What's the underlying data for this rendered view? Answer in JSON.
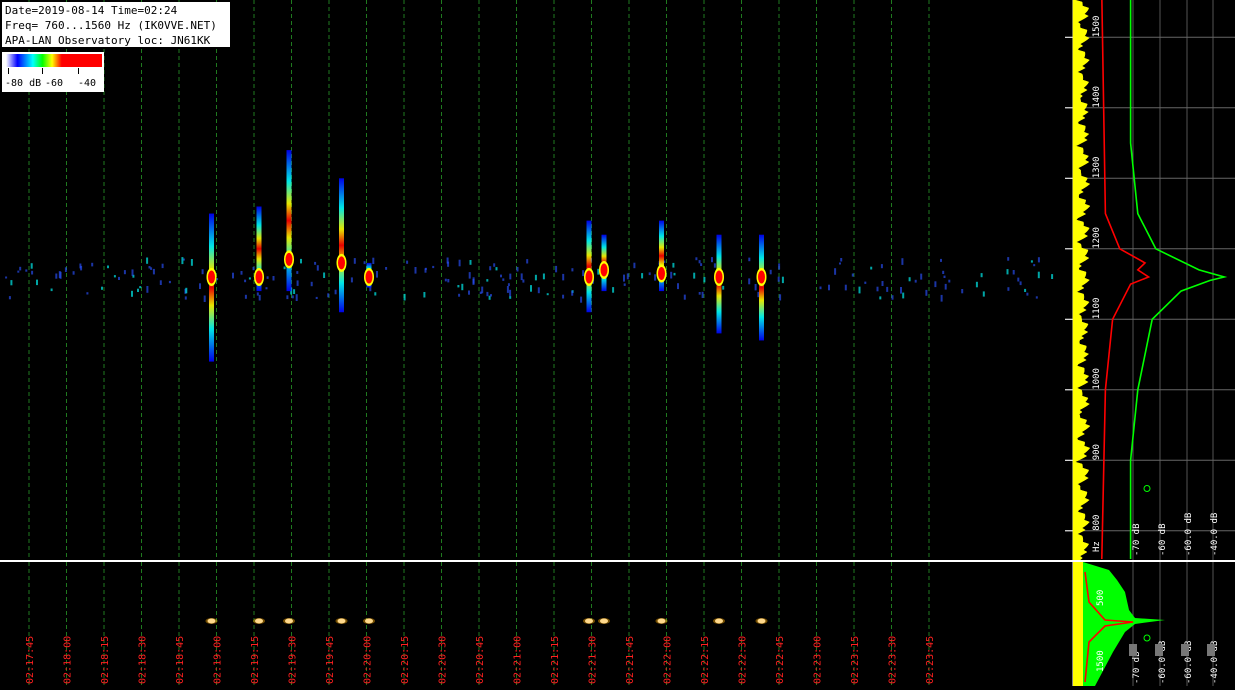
{
  "header": {
    "line1": "Date=2019-08-14 Time=02:24",
    "line2": "Freq= 760...1560 Hz (IK0VVE.NET)",
    "line3": "APA-LAN Observatory loc: JN61KK"
  },
  "scale": {
    "labels": [
      "-80 dB",
      "-60",
      "-40"
    ]
  },
  "colors": {
    "background": "#000000",
    "grid": "#1f7a1f",
    "time_label": "#ff2020",
    "spectrum_peak": "#00ff00",
    "spectrum_avg": "#ff0000",
    "spectrum_inst": "#ffff00"
  },
  "chart_data": [
    {
      "type": "heatmap",
      "title": "Date=2019-08-14 Time=02:24",
      "x_label": "",
      "y_label": "Hz",
      "y_unit": "Hz",
      "yrange": [
        760,
        1560
      ],
      "y_ticks": [
        "800",
        "900",
        "1000",
        "1100",
        "1200",
        "1300",
        "1400",
        "1500"
      ],
      "x_ticks": [
        "02:17:45",
        "02:18:00",
        "02:18:15",
        "02:18:30",
        "02:18:45",
        "02:19:00",
        "02:19:15",
        "02:19:30",
        "02:19:45",
        "02:20:00",
        "02:20:15",
        "02:20:30",
        "02:20:45",
        "02:21:00",
        "02:21:15",
        "02:21:30",
        "02:21:45",
        "02:22:00",
        "02:22:15",
        "02:22:30",
        "02:22:45",
        "02:23:00",
        "02:23:15",
        "02:23:30",
        "02:23:45"
      ],
      "baseline_freq_hz": 1160,
      "events": [
        {
          "time": "02:18:58",
          "freq_hz": 1160,
          "span_hz": [
            1040,
            1250
          ],
          "level_db": -40
        },
        {
          "time": "02:19:17",
          "freq_hz": 1160,
          "span_hz": [
            1140,
            1260
          ],
          "level_db": -45
        },
        {
          "time": "02:19:29",
          "freq_hz": 1185,
          "span_hz": [
            1140,
            1340
          ],
          "level_db": -40
        },
        {
          "time": "02:19:50",
          "freq_hz": 1180,
          "span_hz": [
            1110,
            1300
          ],
          "level_db": -40
        },
        {
          "time": "02:20:01",
          "freq_hz": 1160,
          "span_hz": [
            1145,
            1180
          ],
          "level_db": -45
        },
        {
          "time": "02:21:29",
          "freq_hz": 1160,
          "span_hz": [
            1110,
            1240
          ],
          "level_db": -42
        },
        {
          "time": "02:21:35",
          "freq_hz": 1170,
          "span_hz": [
            1140,
            1220
          ],
          "level_db": -40
        },
        {
          "time": "02:21:58",
          "freq_hz": 1165,
          "span_hz": [
            1140,
            1240
          ],
          "level_db": -40
        },
        {
          "time": "02:22:21",
          "freq_hz": 1160,
          "span_hz": [
            1080,
            1220
          ],
          "level_db": -38
        },
        {
          "time": "02:22:38",
          "freq_hz": 1160,
          "span_hz": [
            1070,
            1220
          ],
          "level_db": -38
        }
      ]
    },
    {
      "type": "line",
      "xlabel": "dB",
      "x_ticks": [
        "-70 dB",
        "-60 dB",
        "-60.0 dB",
        "-40.0 dB"
      ],
      "ylabel": "Hz",
      "y_ticks": [
        "800",
        "900",
        "1000",
        "1100",
        "1200",
        "1300",
        "1400",
        "1500"
      ],
      "yrange": [
        760,
        1560
      ],
      "series": [
        {
          "name": "",
          "color": "#00ff00",
          "points": [
            [
              760,
              -64
            ],
            [
              900,
              -64
            ],
            [
              1000,
              -62
            ],
            [
              1100,
              -58
            ],
            [
              1140,
              -50
            ],
            [
              1155,
              -42
            ],
            [
              1160,
              -38
            ],
            [
              1170,
              -45
            ],
            [
              1200,
              -57
            ],
            [
              1250,
              -62
            ],
            [
              1350,
              -64
            ],
            [
              1560,
              -64
            ]
          ]
        },
        {
          "name": "",
          "color": "#ff0000",
          "points": [
            [
              760,
              -72
            ],
            [
              1000,
              -71
            ],
            [
              1100,
              -69
            ],
            [
              1150,
              -64
            ],
            [
              1160,
              -59
            ],
            [
              1170,
              -62
            ],
            [
              1180,
              -60
            ],
            [
              1200,
              -67
            ],
            [
              1250,
              -71
            ],
            [
              1560,
              -72
            ]
          ]
        }
      ]
    },
    {
      "type": "line",
      "xlabel": "dB",
      "x_ticks": [
        "-70 dB",
        "-60.0 dB",
        "-60.0 dB",
        "-40.0 dB"
      ],
      "ylabel": "Hz",
      "y_ticks": [
        "500",
        "1500"
      ],
      "series": []
    }
  ]
}
